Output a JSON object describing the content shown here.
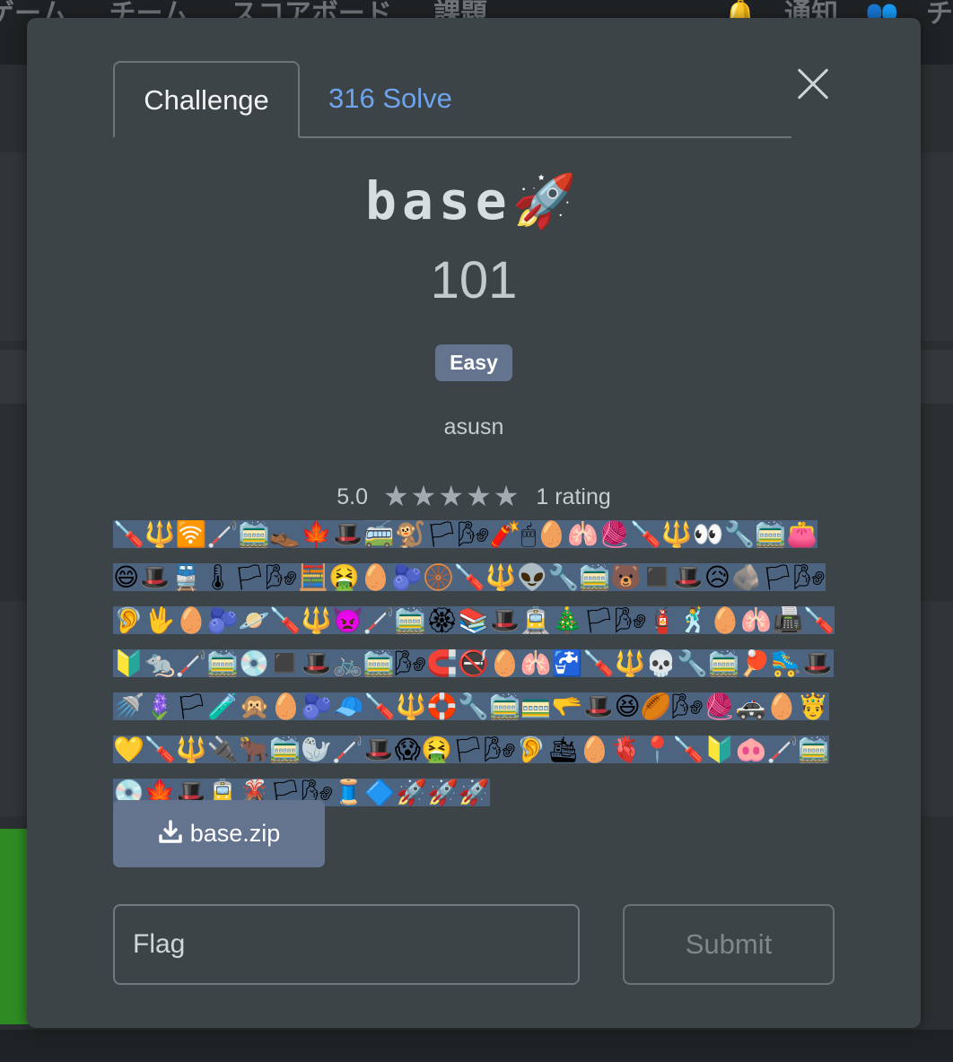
{
  "background": {
    "nav_items": [
      "ゲーム",
      "チーム",
      "スコアボード",
      "課題"
    ],
    "right_items": [
      "🔔",
      "通知",
      "👥",
      "チ"
    ]
  },
  "modal": {
    "tabs": [
      {
        "label": "Challenge"
      },
      {
        "label": "316 Solve"
      }
    ],
    "title": "base🚀",
    "points": "101",
    "difficulty": "Easy",
    "author": "asusn",
    "rating_value": "5.0",
    "stars": "★★★★★",
    "rating_count": "1 rating",
    "description": "🪛🔱🛜🦯🚞👞🍁🎩🚎🐒🏳🌬🧨🖱🥚🫁🧶🪛🔱👀🔧🚞👛😄🎩🚆🌡🏳🌬🧮🤮🥚🫐🛞🪛🔱👽🔧🚞🐻◼️🎩😥🪨🏳🌬🦻🖖🥚🫐🪐🪛🔱👿🦯🚞🏵📚🎩🚊🎄🏳🌬🧯🕺🥚🫁📠🪛🔰🐀🦯🚞💿◼️🎩🚲🚞🌬🧲🚭🥚🫁🚰🪛🔱💀🔧🚞🏓🛼🎩🚿🪻🏳🧪🙊🥚🫐🧢🪛🔱🛟🔧🚞🚃🫳🎩😆🏉🌬🧶🚓🥚🤴💛🪛🔱🔌🐂🚞🦭🦯🎩😱🤮🏳🌬🦻🛳🥚🫀📍🪛🔰🐽🦯🚞💿🍁🎩🚊🌋🏳🌬🧵🔷🚀🚀🚀",
    "download_label": "base.zip",
    "flag_placeholder": "Flag",
    "submit_label": "Submit"
  },
  "colors": {
    "modal_bg": "#3d4447",
    "accent_link": "#6ea4ec",
    "button": "#64748f",
    "description_highlight": "#4c6480"
  },
  "icons": {
    "close": "close-icon",
    "download": "download-icon",
    "star": "star-icon"
  }
}
